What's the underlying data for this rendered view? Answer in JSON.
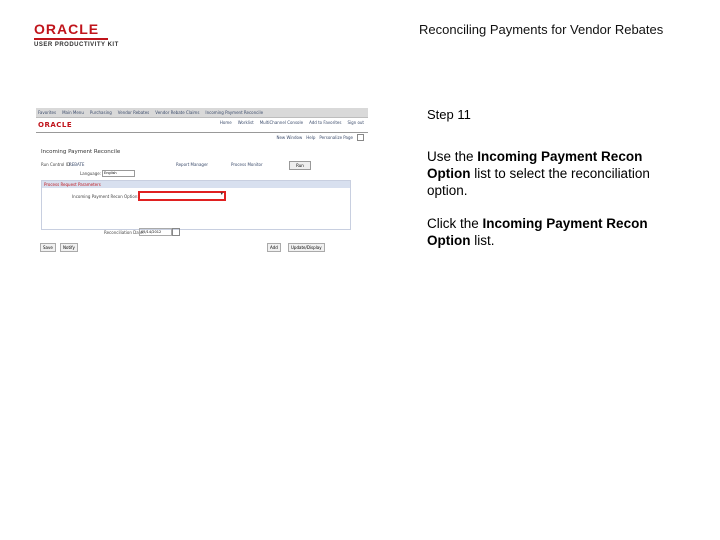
{
  "header": {
    "logo_text": "ORACLE",
    "logo_subtext": "USER PRODUCTIVITY KIT",
    "doc_title": "Reconciling Payments for Vendor Rebates"
  },
  "step": {
    "label": "Step 11",
    "instruction1_pre": "Use the ",
    "instruction1_bold": "Incoming Payment Recon Option",
    "instruction1_post": " list to select the reconciliation option.",
    "instruction2_pre": "Click the ",
    "instruction2_bold": "Incoming Payment Recon Option",
    "instruction2_post": " list."
  },
  "screenshot": {
    "nav_items": [
      "Favorites",
      "Main Menu",
      "Purchasing",
      "Vendor Rebates",
      "Vendor Rebate Claims",
      "Incoming Payment Reconcile"
    ],
    "brand": "ORACLE",
    "top_links": [
      "Home",
      "Worklist",
      "MultiChannel Console",
      "Add to Favorites",
      "Sign out"
    ],
    "sub_links": [
      "New Window",
      "Help",
      "Personalize Page"
    ],
    "page_title": "Incoming Payment Reconcile",
    "fields": {
      "run_control_label": "Run Control ID:",
      "run_control_value": "REBATE",
      "report_manager": "Report Manager",
      "process_monitor": "Process Monitor",
      "run_button": "Run",
      "language_label": "Language:",
      "language_value": "English"
    },
    "section_title": "Process Request Parameters",
    "option_label": "Incoming Payment Recon Option:",
    "option_value": "",
    "date_label": "Reconciliation Date:",
    "date_value": "05/14/2012",
    "buttons": [
      "Save",
      "Notify",
      "Add",
      "Update/Display"
    ]
  },
  "colors": {
    "oracle_red": "#c0141b",
    "highlight_red": "#e02020",
    "nav_text": "#3a4a6a"
  }
}
